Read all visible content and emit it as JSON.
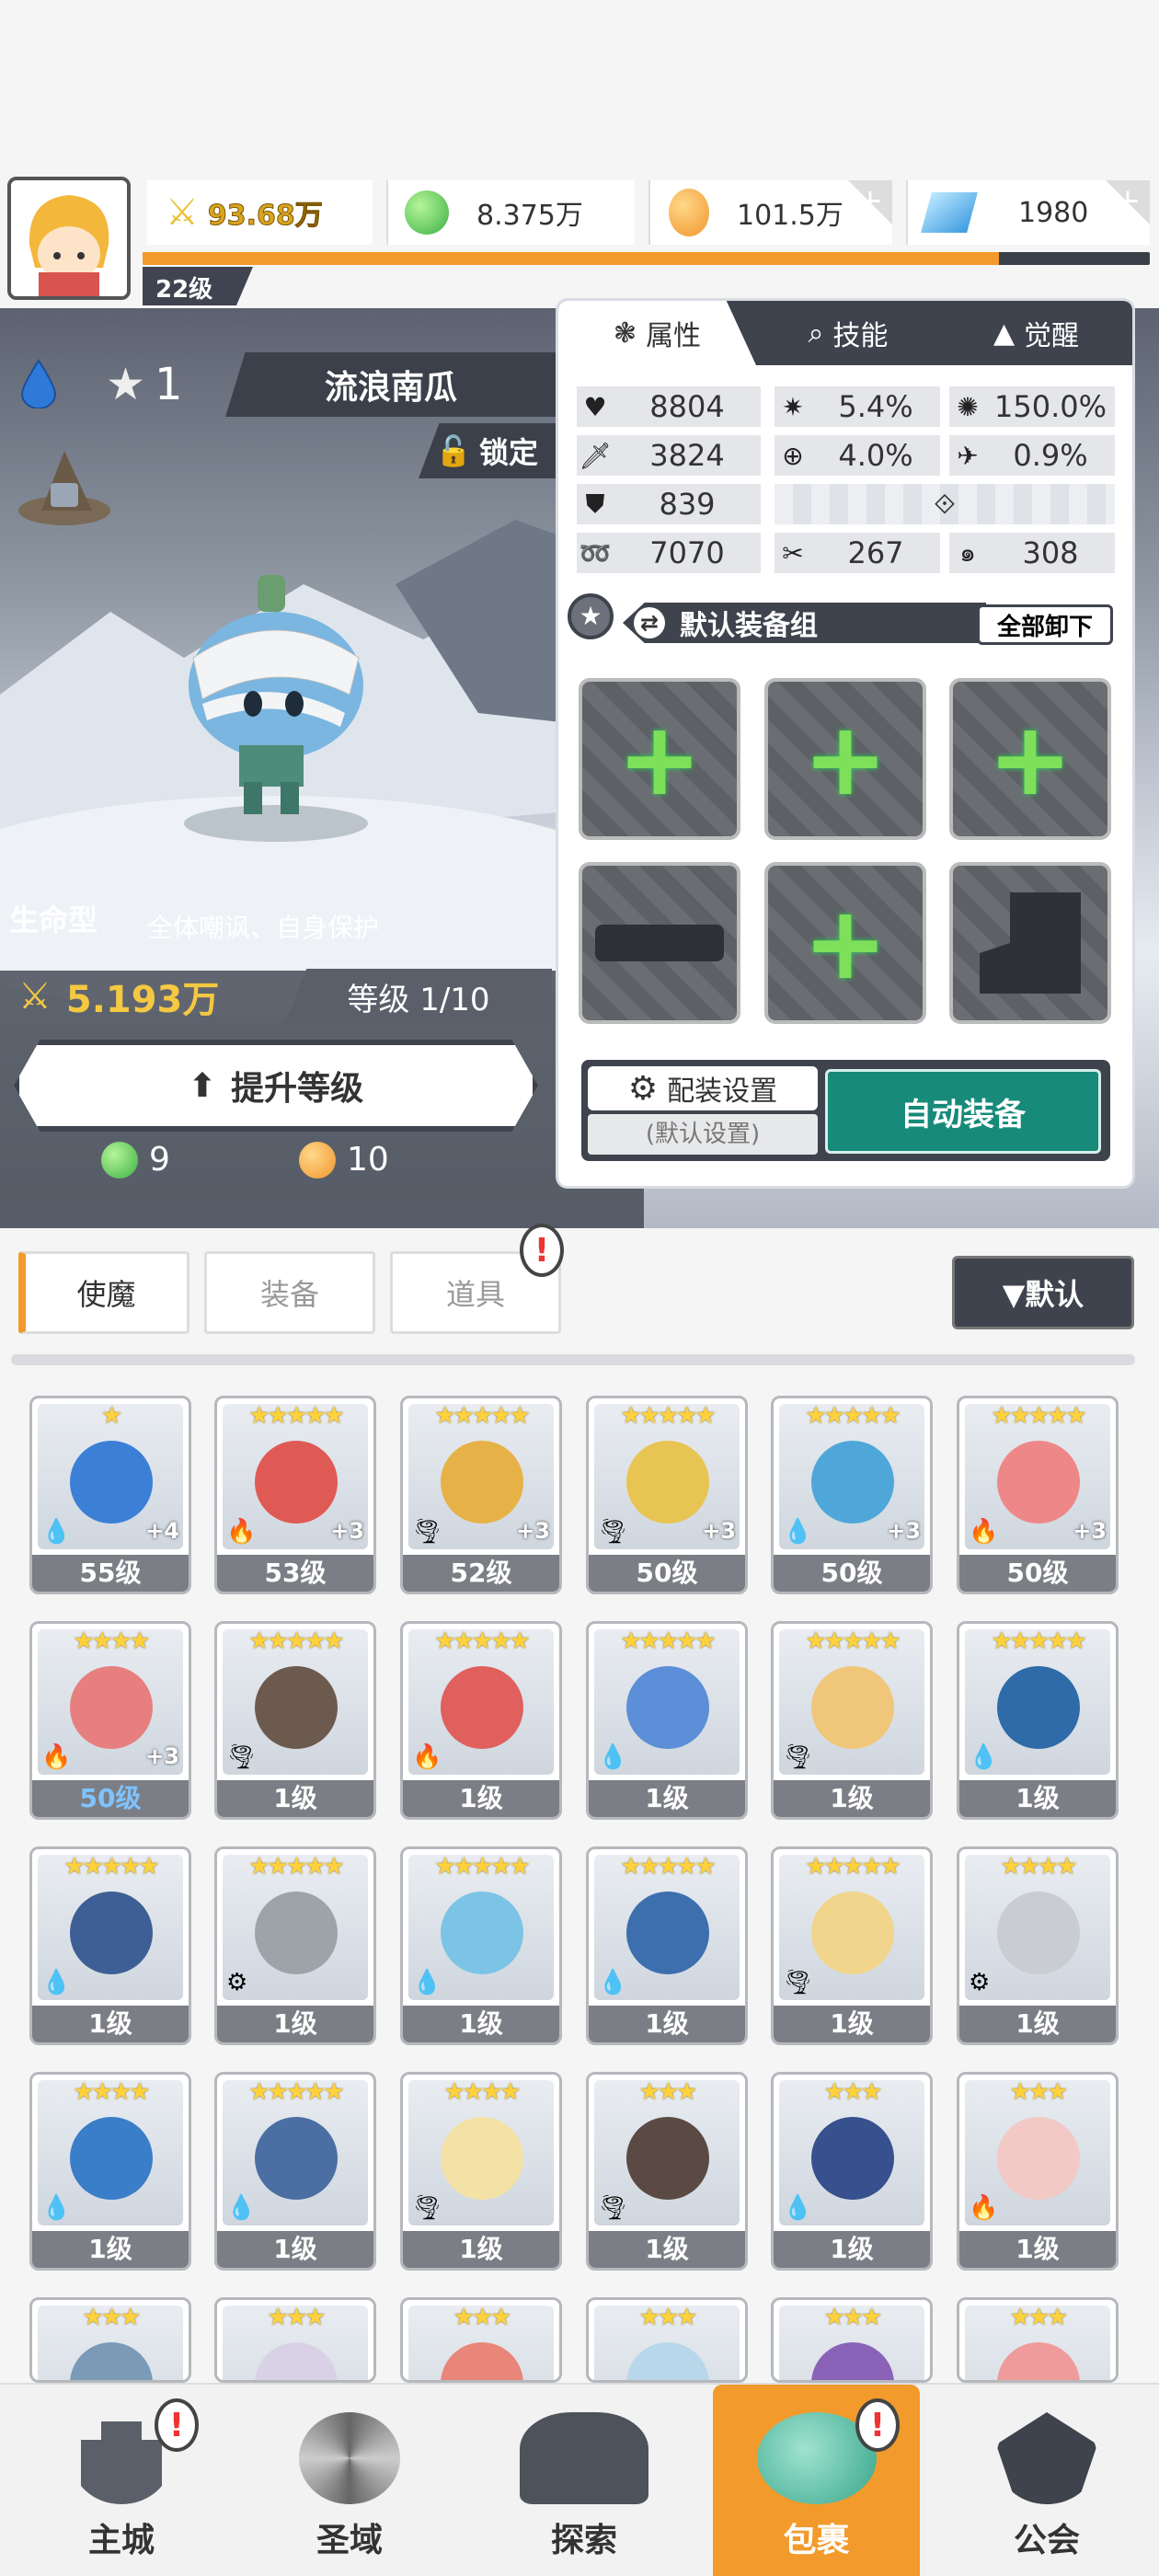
{
  "player": {
    "level": "22级",
    "exp_fraction": 0.85
  },
  "resources": [
    {
      "name": "power",
      "icon": "crossed-swords-icon",
      "value": "93.68万"
    },
    {
      "name": "green-orb",
      "icon": "green-orb-icon",
      "value": "8.375万"
    },
    {
      "name": "gold",
      "icon": "gold-coin-icon",
      "value": "101.5万"
    },
    {
      "name": "diamond",
      "icon": "blue-crystal-icon",
      "value": "1980"
    }
  ],
  "hero": {
    "element": "water",
    "star": "1",
    "name": "流浪南瓜",
    "lock_label": "锁定",
    "type": "生命型",
    "traits": "全体嘲讽、自身保护",
    "power": "5.193万",
    "level": "等级 1/10",
    "upgrade_label": "提升等级",
    "cost_green": "9",
    "cost_gold": "10"
  },
  "panel": {
    "tabs": [
      {
        "label": "属性",
        "icon": "attribute-icon"
      },
      {
        "label": "技能",
        "icon": "skill-icon"
      },
      {
        "label": "觉醒",
        "icon": "awaken-icon"
      }
    ],
    "attrs": [
      {
        "icon": "heart-icon",
        "value": "8804"
      },
      {
        "icon": "burst-icon",
        "value": "5.4%"
      },
      {
        "icon": "sun-icon",
        "value": "150.0%"
      },
      {
        "icon": "sword-icon",
        "value": "3824"
      },
      {
        "icon": "target-icon",
        "value": "4.0%"
      },
      {
        "icon": "dodge-icon",
        "value": "0.9%"
      },
      {
        "icon": "shield-icon",
        "value": "839"
      },
      {
        "icon": "swirl-icon",
        "value": "7070"
      },
      {
        "icon": "slash-icon",
        "value": "267"
      },
      {
        "icon": "spiral-icon",
        "value": "308"
      }
    ],
    "equip_group": "默认装备组",
    "unequip_all": "全部卸下",
    "config_label": "配装设置",
    "config_sub": "(默认设置)",
    "auto_equip": "自动装备"
  },
  "subtabs": [
    "使魔",
    "装备",
    "道具"
  ],
  "sort_label": "▼默认",
  "cards": [
    {
      "stars": "★",
      "lv": "55级",
      "ele": "💧",
      "plus": "+4",
      "color": "#3b7fd6"
    },
    {
      "stars": "★★★★★",
      "lv": "53级",
      "ele": "🔥",
      "plus": "+3",
      "color": "#e05a55"
    },
    {
      "stars": "★★★★★",
      "lv": "52级",
      "ele": "🌪",
      "plus": "+3",
      "color": "#e6b247"
    },
    {
      "stars": "★★★★★",
      "lv": "50级",
      "ele": "🌪",
      "plus": "+3",
      "color": "#e8c553"
    },
    {
      "stars": "★★★★★",
      "lv": "50级",
      "ele": "💧",
      "plus": "+3",
      "color": "#4fa7d9"
    },
    {
      "stars": "★★★★★",
      "lv": "50级",
      "ele": "🔥",
      "plus": "+3",
      "color": "#ee8888"
    },
    {
      "stars": "★★★★",
      "lv": "50级",
      "ele": "🔥",
      "plus": "+3",
      "color": "#e77f7f"
    },
    {
      "stars": "★★★★★",
      "lv": "1级",
      "ele": "🌪",
      "plus": "",
      "color": "#6d5a4e"
    },
    {
      "stars": "★★★★★",
      "lv": "1级",
      "ele": "🔥",
      "plus": "",
      "color": "#e0605e"
    },
    {
      "stars": "★★★★★",
      "lv": "1级",
      "ele": "💧",
      "plus": "",
      "color": "#5d8ed8"
    },
    {
      "stars": "★★★★★",
      "lv": "1级",
      "ele": "🌪",
      "plus": "",
      "color": "#f0c67a"
    },
    {
      "stars": "★★★★★",
      "lv": "1级",
      "ele": "💧",
      "plus": "",
      "color": "#2e6ba8"
    },
    {
      "stars": "★★★★★",
      "lv": "1级",
      "ele": "💧",
      "plus": "",
      "color": "#3e5f95"
    },
    {
      "stars": "★★★★★",
      "lv": "1级",
      "ele": "⚙",
      "plus": "",
      "color": "#9ea3aa"
    },
    {
      "stars": "★★★★★",
      "lv": "1级",
      "ele": "💧",
      "plus": "",
      "color": "#7cc4e6"
    },
    {
      "stars": "★★★★★",
      "lv": "1级",
      "ele": "💧",
      "plus": "",
      "color": "#3d6fae"
    },
    {
      "stars": "★★★★★",
      "lv": "1级",
      "ele": "🌪",
      "plus": "",
      "color": "#f1d58c"
    },
    {
      "stars": "★★★★",
      "lv": "1级",
      "ele": "⚙",
      "plus": "",
      "color": "#c9ccd1"
    },
    {
      "stars": "★★★★",
      "lv": "1级",
      "ele": "💧",
      "plus": "",
      "color": "#3a7dc8"
    },
    {
      "stars": "★★★★★",
      "lv": "1级",
      "ele": "💧",
      "plus": "",
      "color": "#4b6fa3"
    },
    {
      "stars": "★★★★",
      "lv": "1级",
      "ele": "🌪",
      "plus": "",
      "color": "#f3e1a6"
    },
    {
      "stars": "★★★",
      "lv": "1级",
      "ele": "🌪",
      "plus": "",
      "color": "#5b4a44"
    },
    {
      "stars": "★★★",
      "lv": "1级",
      "ele": "💧",
      "plus": "",
      "color": "#37508e"
    },
    {
      "stars": "★★★",
      "lv": "1级",
      "ele": "🔥",
      "plus": "",
      "color": "#f2c9c4"
    },
    {
      "stars": "★★★",
      "lv": "",
      "ele": "",
      "plus": "",
      "color": "#7a9ab8"
    },
    {
      "stars": "★★★",
      "lv": "",
      "ele": "",
      "plus": "",
      "color": "#d9d2e6"
    },
    {
      "stars": "★★★",
      "lv": "",
      "ele": "",
      "plus": "",
      "color": "#e9867a"
    },
    {
      "stars": "★★★",
      "lv": "",
      "ele": "",
      "plus": "",
      "color": "#b9d7ea"
    },
    {
      "stars": "★★★",
      "lv": "",
      "ele": "",
      "plus": "",
      "color": "#8a63b8"
    },
    {
      "stars": "★★★",
      "lv": "",
      "ele": "",
      "plus": "",
      "color": "#f09b9b"
    }
  ],
  "nav": [
    {
      "label": "主城",
      "icon": "castle-icon"
    },
    {
      "label": "圣域",
      "icon": "vortex-icon"
    },
    {
      "label": "探索",
      "icon": "sword-stone-icon"
    },
    {
      "label": "包裹",
      "icon": "bag-icon"
    },
    {
      "label": "公会",
      "icon": "guild-icon"
    }
  ],
  "alert_mark": "!"
}
